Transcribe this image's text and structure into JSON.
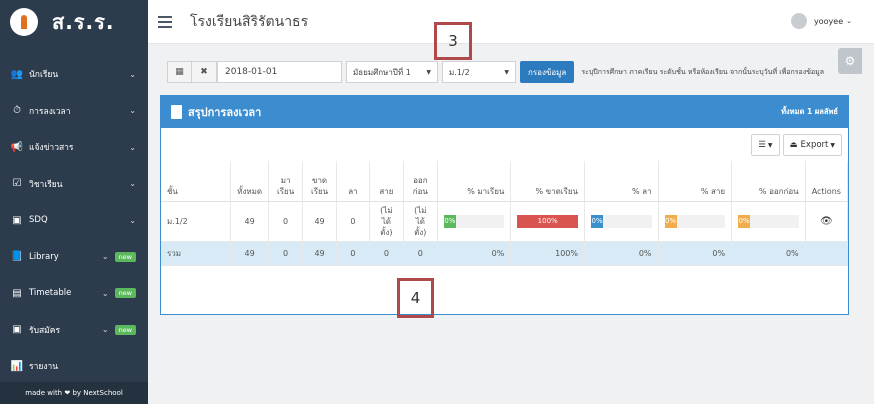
{
  "sidebar": {
    "brand": "ส.ร.ร.",
    "items": [
      {
        "label": "นักเรียน",
        "icon": "users-icon",
        "badge": ""
      },
      {
        "label": "การลงเวลา",
        "icon": "clock-icon",
        "badge": ""
      },
      {
        "label": "แจ้งข่าวสาร",
        "icon": "megaphone-icon",
        "badge": ""
      },
      {
        "label": "วิชาเรียน",
        "icon": "calendar-check-icon",
        "badge": ""
      },
      {
        "label": "SDQ",
        "icon": "id-card-icon",
        "badge": ""
      },
      {
        "label": "Library",
        "icon": "book-icon",
        "badge": "new"
      },
      {
        "label": "Timetable",
        "icon": "database-icon",
        "badge": "new"
      },
      {
        "label": "รับสมัคร",
        "icon": "id-card-icon",
        "badge": "new"
      },
      {
        "label": "รายงาน",
        "icon": "bar-chart-icon",
        "badge": ""
      }
    ],
    "footer": "made with ❤ by NextSchool"
  },
  "topbar": {
    "title": "โรงเรียนสิริรัตนาธร",
    "username": "yooyee"
  },
  "filters": {
    "date": "2018-01-01",
    "level": "มัธยมศึกษาปีที่ 1",
    "room": "ม.1/2",
    "submit": "กรองข้อมูล",
    "hint": "ระบุปีการศึกษา ภาคเรียน ระดับชั้น หรือห้องเรียน จากนั้นระบุวันที่ เพื่อกรองข้อมูล"
  },
  "panel": {
    "title": "สรุปการลงเวลา",
    "count": "ทั้งหมด 1 ผลลัพธ์",
    "export": "Export"
  },
  "table": {
    "headers": [
      "ชั้น",
      "ทั้งหมด",
      "มา\nเรียน",
      "ขาด\nเรียน",
      "ลา",
      "สาย",
      "ออก\nก่อน",
      "% มาเรียน",
      "% ขาดเรียน",
      "% ลา",
      "% สาย",
      "% ออกก่อน",
      "Actions"
    ],
    "row": {
      "class": "ม.1/2",
      "total": "49",
      "present": "0",
      "absent": "49",
      "leave": "0",
      "late": "(ไม่ได้\nตั้ง)",
      "early": "(ไม่ได้\nตั้ง)",
      "pct_present": "0%",
      "pct_absent": "100%",
      "pct_leave": "0%",
      "pct_late": "0%",
      "pct_early": "0%",
      "pct_present_value": 0,
      "pct_absent_value": 100,
      "pct_leave_value": 0,
      "pct_late_value": 0,
      "pct_early_value": 0
    },
    "total_row": {
      "label": "รวม",
      "total": "49",
      "present": "0",
      "absent": "49",
      "leave": "0",
      "late": "0",
      "early": "0",
      "pct_present": "0%",
      "pct_absent": "100%",
      "pct_leave": "0%",
      "pct_late": "0%",
      "pct_early": "0%"
    }
  },
  "annotations": [
    "3",
    "4"
  ],
  "colors": {
    "sidebar": "#2c3c4c",
    "primary": "#3c8dcf",
    "success": "#5cb85c",
    "danger": "#d9534f",
    "info": "#3a8fcd",
    "warning": "#f0ad4e",
    "annotation": "#b04a4a"
  }
}
